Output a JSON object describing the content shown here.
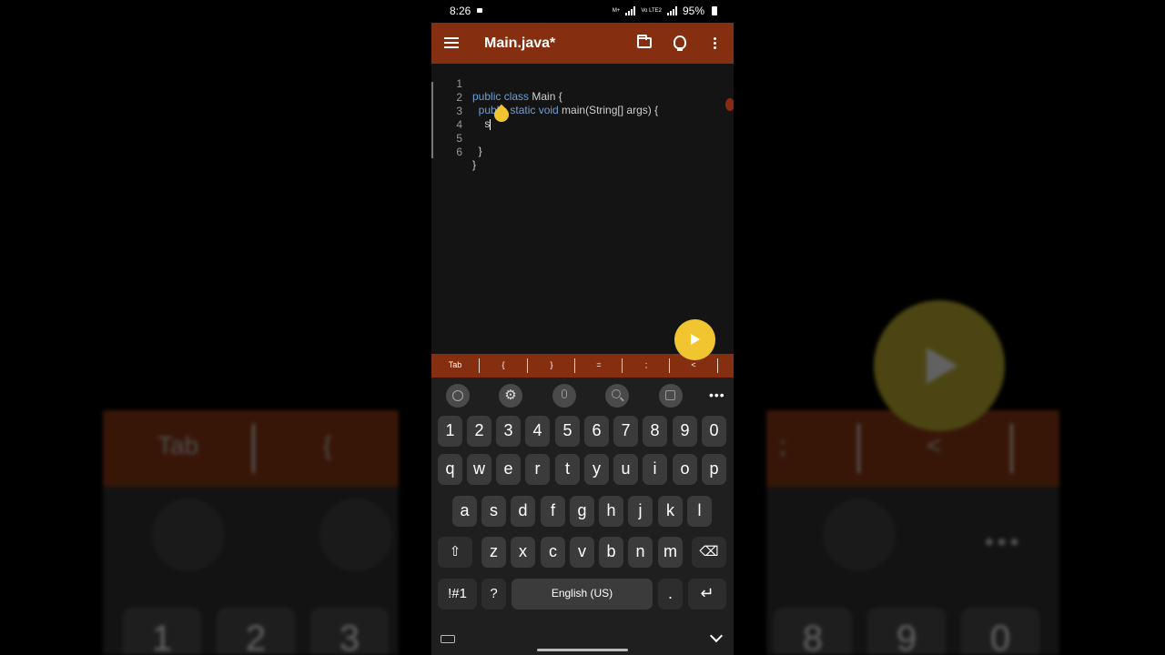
{
  "status_bar": {
    "time": "8:26",
    "net1": "M+",
    "net2": "Vo LTE2",
    "battery": "95%"
  },
  "app_bar": {
    "title": "Main.java*",
    "menu_icon": "hamburger-menu-icon",
    "folder_icon": "folder-icon",
    "bulb_icon": "lightbulb-icon",
    "more_icon": "more-vert-icon"
  },
  "editor": {
    "lines": [
      {
        "num": "1",
        "kw": "public class",
        "rest": " Main {",
        "indent": ""
      },
      {
        "num": "2",
        "kw": "public static void",
        "rest": " main(String[] args) {",
        "indent": "  "
      },
      {
        "num": "3",
        "kw": "",
        "rest": "s",
        "indent": "    "
      },
      {
        "num": "4",
        "kw": "",
        "rest": "",
        "indent": ""
      },
      {
        "num": "5",
        "kw": "",
        "rest": "}",
        "indent": "  "
      },
      {
        "num": "6",
        "kw": "",
        "rest": "}",
        "indent": ""
      }
    ]
  },
  "run_button_icon": "play-icon",
  "symbol_bar": [
    "Tab",
    "{",
    "}",
    "=",
    ";",
    "<"
  ],
  "keyboard": {
    "toolbar_icons": [
      "emoji-icon",
      "settings-gear-icon",
      "microphone-icon",
      "search-icon",
      "translate-icon",
      "more-horiz-icon"
    ],
    "more_label": "•••",
    "row_numbers": [
      "1",
      "2",
      "3",
      "4",
      "5",
      "6",
      "7",
      "8",
      "9",
      "0"
    ],
    "row_q": [
      "q",
      "w",
      "e",
      "r",
      "t",
      "y",
      "u",
      "i",
      "o",
      "p"
    ],
    "row_a": [
      "a",
      "s",
      "d",
      "f",
      "g",
      "h",
      "j",
      "k",
      "l"
    ],
    "row_z": [
      "z",
      "x",
      "c",
      "v",
      "b",
      "n",
      "m"
    ],
    "shift_label": "⇧",
    "backspace_label": "⌫",
    "symbols_label": "!#1",
    "question_label": "?",
    "space_label": "English (US)",
    "period_label": ".",
    "enter_label": "↵"
  },
  "background": {
    "left_band_tab": "Tab",
    "left_band_brace": "{",
    "right_band_semicolon": ";",
    "right_band_lt": "<",
    "left_keys": [
      "1",
      "2",
      "3"
    ],
    "right_keys": [
      "8",
      "9",
      "0"
    ],
    "right_dots": "•••"
  }
}
